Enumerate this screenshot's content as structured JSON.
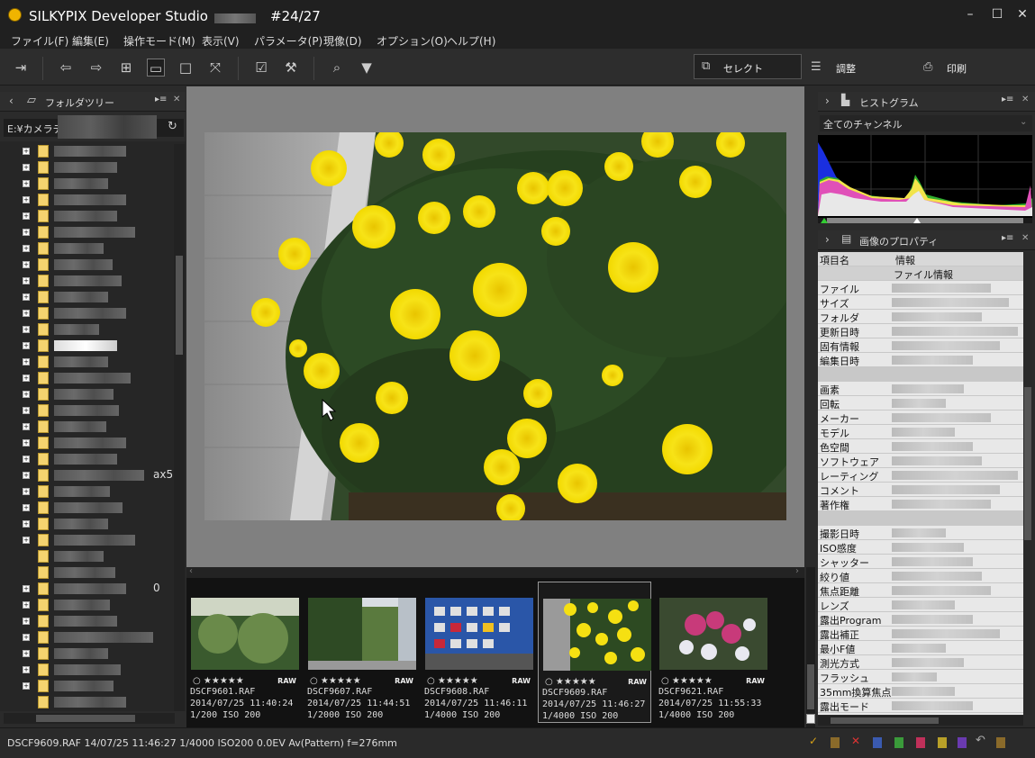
{
  "window": {
    "title": "SILKYPIX Developer Studio",
    "counter": "#24/27",
    "controls": {
      "minimize": "–",
      "maximize": "☐",
      "close": "✕"
    }
  },
  "menu": {
    "items": [
      "ファイル(F)",
      "編集(E)",
      "操作モード(M)",
      "表示(V)",
      "パラメータ(P)",
      "現像(D)",
      "オプション(O)",
      "ヘルプ(H)"
    ]
  },
  "toolbar": {
    "select_label": "セレクト",
    "adjust_label": "調整",
    "print_label": "印刷"
  },
  "folder_panel": {
    "title": "フォルダツリー",
    "path": "E:¥カメラデ",
    "frag_1": "ax5",
    "frag_2": "0"
  },
  "histogram_panel": {
    "title": "ヒストグラム",
    "channel": "全てのチャンネル"
  },
  "properties_panel": {
    "title": "画像のプロパティ",
    "col_name": "項目名",
    "col_info": "情報",
    "section_file": "ファイル情報",
    "rows_a": [
      "ファイル",
      "サイズ",
      "フォルダ",
      "更新日時",
      "固有情報",
      "編集日時"
    ],
    "rows_b": [
      "画素",
      "回転",
      "メーカー",
      "モデル",
      "色空間",
      "ソフトウェア",
      "レーティング",
      "コメント",
      "著作権"
    ],
    "rows_c": [
      "撮影日時",
      "ISO感度",
      "シャッター",
      "絞り値",
      "焦点距離",
      "レンズ",
      "露出Program",
      "露出補正",
      "最小F値",
      "測光方式",
      "フラッシュ",
      "35mm換算焦点",
      "露出モード"
    ]
  },
  "filmstrip": {
    "thumbs": [
      {
        "name": "DSCF9601.RAF",
        "date": "2014/07/25 11:40:24",
        "exposure": "1/200 ISO 200",
        "stars": "○ ★★★★★",
        "raw": "RAW"
      },
      {
        "name": "DSCF9607.RAF",
        "date": "2014/07/25 11:44:51",
        "exposure": "1/2000 ISO 200",
        "stars": "○ ★★★★★",
        "raw": "RAW"
      },
      {
        "name": "DSCF9608.RAF",
        "date": "2014/07/25 11:46:11",
        "exposure": "1/4000 ISO 200",
        "stars": "○ ★★★★★",
        "raw": "RAW"
      },
      {
        "name": "DSCF9609.RAF",
        "date": "2014/07/25 11:46:27",
        "exposure": "1/4000 ISO 200",
        "stars": "○ ★★★★★",
        "raw": "RAW"
      },
      {
        "name": "DSCF9621.RAF",
        "date": "2014/07/25 11:55:33",
        "exposure": "1/4000 ISO 200",
        "stars": "○ ★★★★★",
        "raw": "RAW"
      }
    ]
  },
  "status": {
    "text": "DSCF9609.RAF 14/07/25 11:46:27 1/4000 ISO200  0.0EV Av(Pattern) f=276mm"
  },
  "colors": {
    "accent_yellow": "#f0b400",
    "flower_yellow": "#f5e012",
    "leaf_green": "#2f4a26"
  }
}
